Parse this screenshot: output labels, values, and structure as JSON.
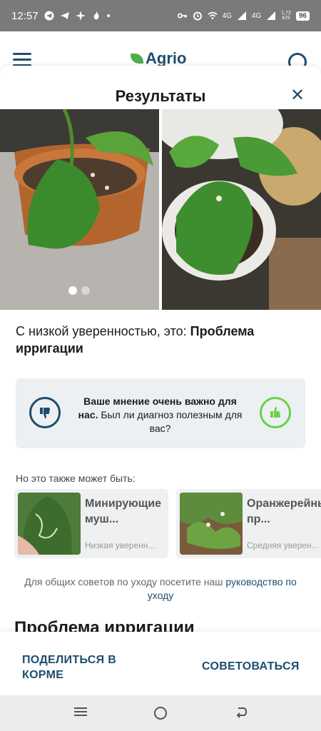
{
  "status_bar": {
    "time": "12:57",
    "dot": "•",
    "network_1": "4G",
    "network_2": "4G",
    "speed_value": "1,72",
    "speed_unit": "K/S",
    "battery": "96",
    "icons": [
      "telegram-icon",
      "telegram-icon",
      "sparkle-icon",
      "flame-icon",
      "key-icon",
      "alarm-icon",
      "wifi-icon",
      "signal-icon",
      "signal-icon"
    ]
  },
  "header": {
    "logo_text": "Agrio"
  },
  "results": {
    "title": "Результаты",
    "close_icon": "close-icon",
    "gallery_count": 2,
    "gallery_active_index": 0
  },
  "diagnosis": {
    "prefix": "С низкой уверенностью, это: ",
    "name": "Проблема ирригации"
  },
  "feedback": {
    "bold": "Ваше мнение очень важно для нас.",
    "rest": " Был ли диагноз полезным для вас?",
    "thumb_down_icon": "thumbs-down-icon",
    "thumb_up_icon": "thumbs-up-icon",
    "accent_negative": "#1c4e6e",
    "accent_positive": "#6ad14a"
  },
  "alternatives": {
    "label": "Но это также может быть:",
    "items": [
      {
        "name": "Минирующие муш...",
        "confidence": "Низкая уверенн..."
      },
      {
        "name": "Оранжерейный пр...",
        "confidence": "Средняя уверен..."
      }
    ]
  },
  "care_tip": {
    "text": "Для общих советов по уходу посетите наш ",
    "link": "руководство по уходу"
  },
  "section_heading": "Проблема ирригации",
  "bottom_bar": {
    "share_label": "ПОДЕЛИТЬСЯ В КОРМЕ",
    "consult_label": "СОВЕТОВАТЬСЯ"
  },
  "colors": {
    "brand": "#1c4e6e",
    "status_bar": "#7a7a7a"
  }
}
